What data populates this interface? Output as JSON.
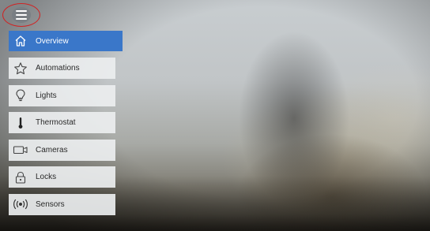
{
  "menu": {
    "icon": "hamburger-menu-icon",
    "highlight_color": "#d02424"
  },
  "nav": {
    "accent_color": "#3a77c9",
    "items": [
      {
        "label": "Overview",
        "icon": "home-icon",
        "active": true
      },
      {
        "label": "Automations",
        "icon": "star-icon",
        "active": false
      },
      {
        "label": "Lights",
        "icon": "lightbulb-icon",
        "active": false
      },
      {
        "label": "Thermostat",
        "icon": "thermometer-icon",
        "active": false
      },
      {
        "label": "Cameras",
        "icon": "camera-icon",
        "active": false
      },
      {
        "label": "Locks",
        "icon": "lock-icon",
        "active": false
      },
      {
        "label": "Sensors",
        "icon": "sensor-icon",
        "active": false
      }
    ]
  }
}
